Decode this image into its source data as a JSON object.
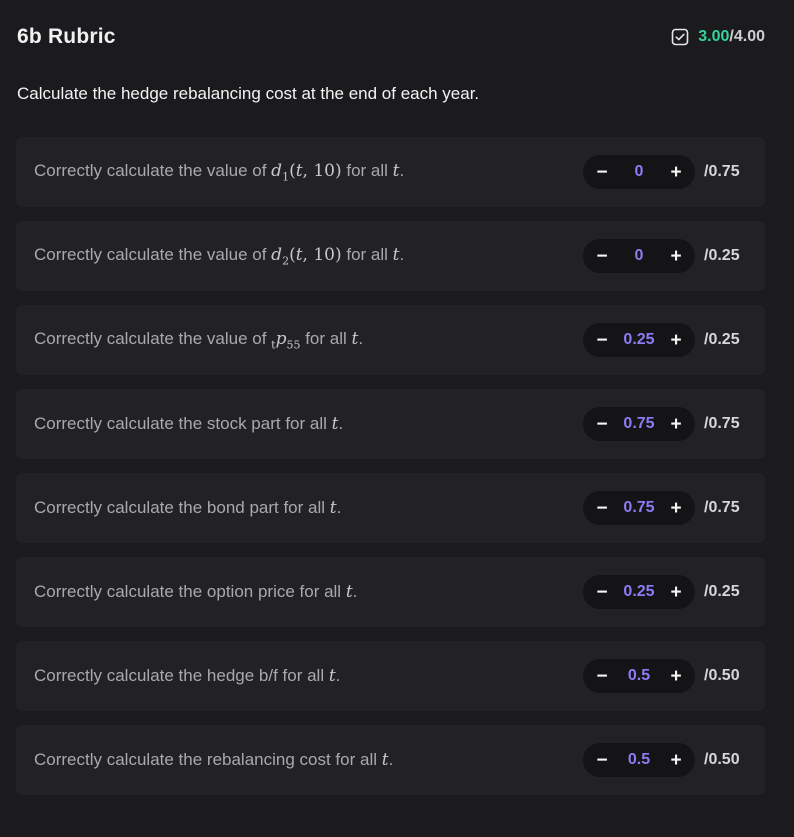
{
  "rubric": {
    "title": "6b Rubric",
    "score_earned": "3.00",
    "score_total": "/4.00",
    "description": "Calculate the hedge rebalancing cost at the end of each year.",
    "colors": {
      "earned": "#34d399",
      "value": "#8b7cf6"
    }
  },
  "criteria": [
    {
      "prefix": "Correctly calculate the value of ",
      "math": "d1(t, 10)",
      "suffix": " for all ",
      "var": "t",
      "end": ".",
      "value": "0",
      "max": "/0.75"
    },
    {
      "prefix": "Correctly calculate the value of ",
      "math": "d2(t, 10)",
      "suffix": " for all ",
      "var": "t",
      "end": ".",
      "value": "0",
      "max": "/0.25"
    },
    {
      "prefix": "Correctly calculate the value of ",
      "math": "tp55",
      "suffix": " for all ",
      "var": "t",
      "end": ".",
      "value": "0.25",
      "max": "/0.25"
    },
    {
      "prefix": "Correctly calculate the stock part for all ",
      "math": "",
      "suffix": "",
      "var": "t",
      "end": ".",
      "value": "0.75",
      "max": "/0.75"
    },
    {
      "prefix": "Correctly calculate the bond part for all ",
      "math": "",
      "suffix": "",
      "var": "t",
      "end": ".",
      "value": "0.75",
      "max": "/0.75"
    },
    {
      "prefix": "Correctly calculate the option price for all ",
      "math": "",
      "suffix": "",
      "var": "t",
      "end": ".",
      "value": "0.25",
      "max": "/0.25"
    },
    {
      "prefix": "Correctly calculate the hedge b/f for all ",
      "math": "",
      "suffix": "",
      "var": "t",
      "end": ".",
      "value": "0.5",
      "max": "/0.50"
    },
    {
      "prefix": "Correctly calculate the rebalancing cost for all ",
      "math": "",
      "suffix": "",
      "var": "t",
      "end": ".",
      "value": "0.5",
      "max": "/0.50"
    }
  ],
  "stepper": {
    "minus": "−",
    "plus": "+"
  }
}
